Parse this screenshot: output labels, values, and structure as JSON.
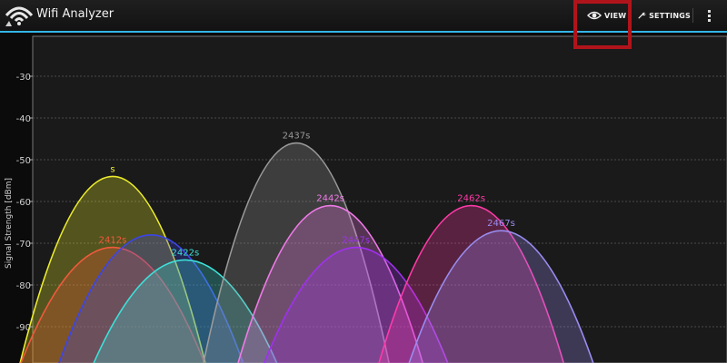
{
  "app": {
    "title": "Wifi Analyzer",
    "icon": "wifi-analyzer-icon"
  },
  "toolbar": {
    "view_label": "VIEW",
    "view_icon": "eye-icon",
    "settings_label": "SETTINGS",
    "settings_icon": "wrench-icon",
    "overflow_icon": "overflow-menu-icon",
    "accent_color": "#33b5e5",
    "highlight_color": "#b0141b"
  },
  "chart_data": {
    "type": "area",
    "ylabel": "Signal Strength [dBm]",
    "xlabel": "",
    "ylim": [
      -100,
      -20
    ],
    "yticks": [
      -30,
      -40,
      -50,
      -60,
      -70,
      -80,
      -90
    ],
    "grid": true,
    "series": [
      {
        "name": "s",
        "channel": 1.9,
        "peak": -54,
        "color": "#ecec2c"
      },
      {
        "name": "2412s",
        "channel": 1.9,
        "peak": -71,
        "color": "#f05a3c"
      },
      {
        "name": "",
        "channel": 2.8,
        "peak": -68,
        "color": "#3c46e8"
      },
      {
        "name": "2422s",
        "channel": 3.6,
        "peak": -74,
        "color": "#3de0d8"
      },
      {
        "name": "2437s",
        "channel": 6.2,
        "peak": -46,
        "color": "#9a9a9a"
      },
      {
        "name": "2442s",
        "channel": 7.0,
        "peak": -61,
        "color": "#f07ae8"
      },
      {
        "name": "2447s",
        "channel": 7.6,
        "peak": -71,
        "color": "#a030f0"
      },
      {
        "name": "2462s",
        "channel": 10.3,
        "peak": -61,
        "color": "#ff3aa8"
      },
      {
        "name": "2467s",
        "channel": 11.0,
        "peak": -67,
        "color": "#9a8cf0"
      }
    ]
  }
}
